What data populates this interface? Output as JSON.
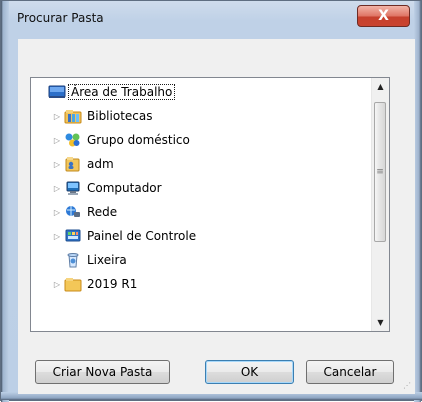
{
  "window": {
    "title": "Procurar Pasta",
    "close_symbol": "X"
  },
  "tree": {
    "items": [
      {
        "label": "Área de Trabalho",
        "icon": "desktop-icon",
        "expander": "",
        "selected": true
      },
      {
        "label": "Bibliotecas",
        "icon": "libraries-icon",
        "expander": "▷",
        "selected": false
      },
      {
        "label": "Grupo doméstico",
        "icon": "homegroup-icon",
        "expander": "▷",
        "selected": false
      },
      {
        "label": "adm",
        "icon": "user-folder-icon",
        "expander": "▷",
        "selected": false
      },
      {
        "label": "Computador",
        "icon": "computer-icon",
        "expander": "▷",
        "selected": false
      },
      {
        "label": "Rede",
        "icon": "network-icon",
        "expander": "▷",
        "selected": false
      },
      {
        "label": "Painel de Controle",
        "icon": "control-panel-icon",
        "expander": "▷",
        "selected": false
      },
      {
        "label": "Lixeira",
        "icon": "recycle-bin-icon",
        "expander": "",
        "selected": false
      },
      {
        "label": "2019 R1",
        "icon": "folder-icon",
        "expander": "▷",
        "selected": false
      }
    ],
    "scrollbar": {
      "up_arrow": "▲",
      "down_arrow": "▼",
      "grip": "≡"
    }
  },
  "buttons": {
    "new_folder": "Criar Nova Pasta",
    "ok": "OK",
    "cancel": "Cancelar"
  },
  "resize_grip": "⋰"
}
